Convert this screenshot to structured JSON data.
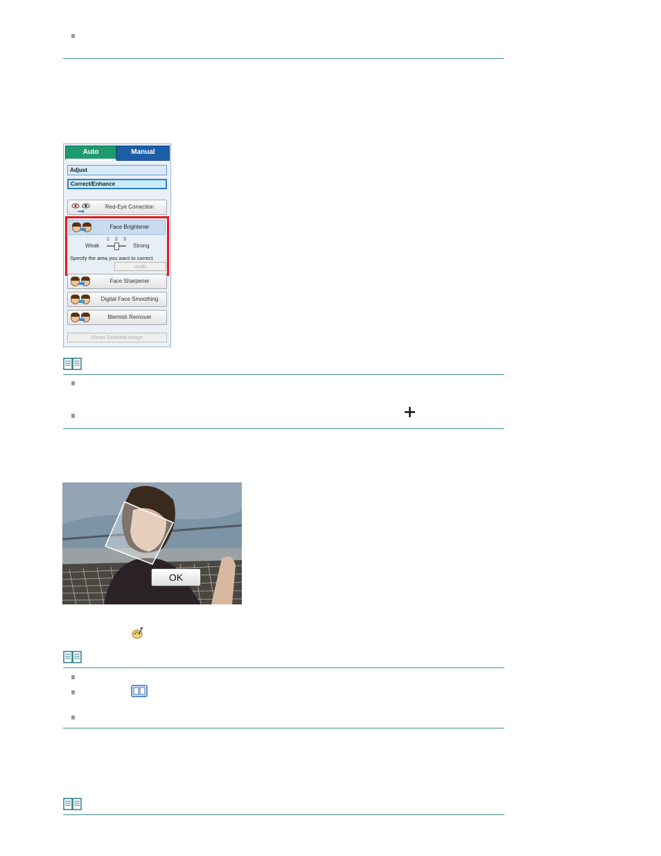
{
  "panel": {
    "tabs": [
      {
        "label": "Auto"
      },
      {
        "label": "Manual"
      }
    ],
    "categories": [
      {
        "label": "Adjust"
      },
      {
        "label": "Correct/Enhance"
      }
    ],
    "tools": [
      {
        "label": "Red-Eye Correction"
      },
      {
        "label": "Face Brightener"
      },
      {
        "label": "Face Sharpener"
      },
      {
        "label": "Digital Face Smoothing"
      },
      {
        "label": "Blemish Remover"
      }
    ],
    "slider": {
      "weak_label": "Weak",
      "strong_label": "Strong",
      "ticks": [
        "1",
        "2",
        "3"
      ],
      "value": 2
    },
    "instruction": "Specify the area you want to correct",
    "undo_label": "Undo",
    "reset_label": "Reset Selected Image"
  },
  "photo": {
    "ok_label": "OK"
  },
  "icons": {
    "note": "book-note-icon",
    "crosshair": "plus-cursor-icon",
    "palette": "palette-brush-icon",
    "compare": "compare-view-icon"
  },
  "colors": {
    "rule": "#3f8f8f",
    "highlight": "#e21b1b",
    "tab_auto": "#1d9a6e",
    "tab_manual": "#1d5ea8"
  }
}
